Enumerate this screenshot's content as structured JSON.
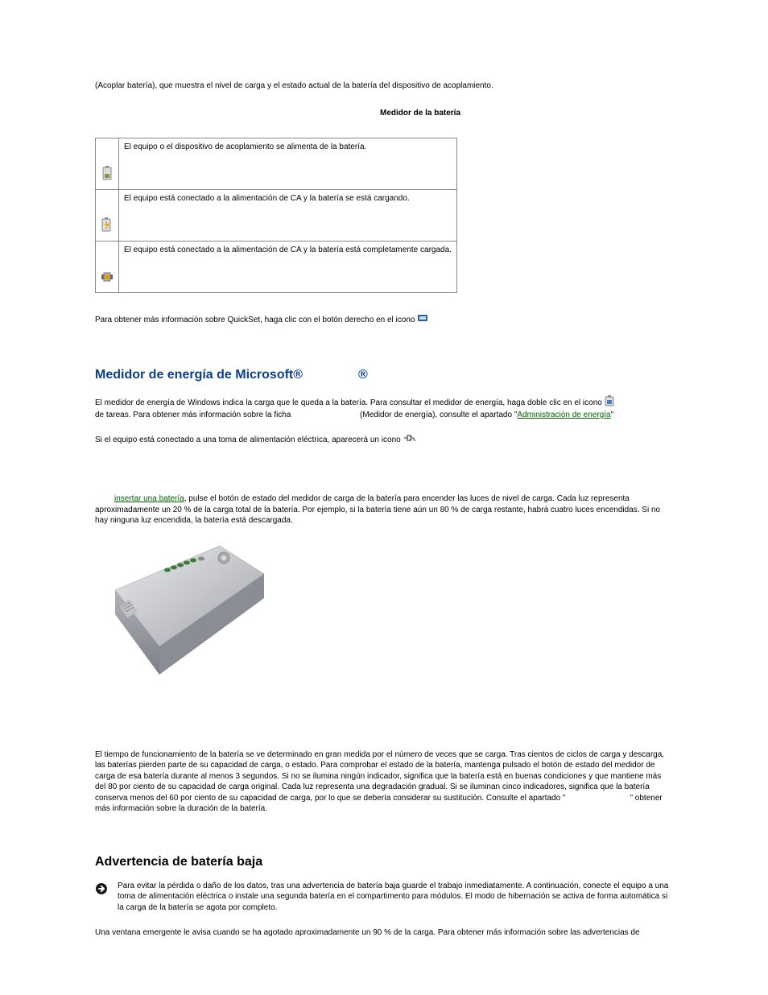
{
  "intro": "(Acoplar batería), que muestra el nivel de carga y el estado actual de la batería del dispositivo de acoplamiento.",
  "table_caption": "Medidor de la batería",
  "table_rows": [
    {
      "icon": "battery",
      "text": "El equipo o el dispositivo de acoplamiento se alimenta de la batería."
    },
    {
      "icon": "battery-charging",
      "text": "El equipo está conectado a la alimentación de CA y la batería se está cargando."
    },
    {
      "icon": "battery-full",
      "text": "El equipo está conectado a la alimentación de CA y la batería está completamente cargada."
    }
  ],
  "quickset_text": "Para obtener más información sobre QuickSet, haga clic con el botón derecho en el icono",
  "heading_1_a": "Medidor de energía de Microsoft®",
  "heading_1_b": "®",
  "windows_meter_1": "El medidor de energía de Windows indica la carga que le queda a la batería. Para consultar el medidor de energía, haga doble clic en el icono",
  "windows_meter_2a": "de tareas. Para obtener más información sobre la ficha",
  "windows_meter_2b": "(Medidor de energía), consulte el apartado \"",
  "windows_meter_link": "Administración de energía",
  "windows_meter_2c": "\"",
  "plug_text": "Si el equipo está conectado a una toma de alimentación eléctrica, aparecerá un icono",
  "insert_link": "insertar una batería",
  "charge_para": ", pulse el botón de estado del medidor de carga de la batería para encender las luces de nivel de carga. Cada luz representa aproximadamente un 20 % de la carga total de la batería. Por ejemplo, si la batería tiene aún un 80 % de carga restante, habrá cuatro luces encendidas. Si no hay ninguna luz encendida, la batería está descargada.",
  "health_para_a": "El tiempo de funcionamiento de la batería se ve determinado en gran medida por el número de veces que se carga. Tras cientos de ciclos de carga y descarga, las baterías pierden parte de su capacidad de carga, o estado. Para comprobar el estado de la batería, mantenga pulsado el botón de estado del medidor de carga de esa batería durante al menos 3 segundos. Si no se ilumina ningún indicador, significa que la batería está en buenas condiciones y que mantiene más del 80 por ciento de su capacidad de carga original. Cada luz representa una degradación gradual. Si se iluminan cinco indicadores, significa que la batería conserva menos del 60 por ciento de su capacidad de carga, por lo que se debería considerar su sustitución. Consulte el apartado \"",
  "health_para_b": "\" obtener más información sobre la duración de la batería.",
  "heading_2": "Advertencia de batería baja",
  "notice_text": "Para evitar la pérdida o daño de los datos, tras una advertencia de batería baja guarde el trabajo inmediatamente. A continuación, conecte el equipo a una toma de alimentación eléctrica o instale una segunda batería en el compartimento para módulos. El modo de hibernación se activa de forma automática si la carga de la batería se agota por completo.",
  "final_para": "Una ventana emergente le avisa cuando se ha agotado aproximadamente un 90 % de la carga. Para obtener más información sobre las advertencias de"
}
